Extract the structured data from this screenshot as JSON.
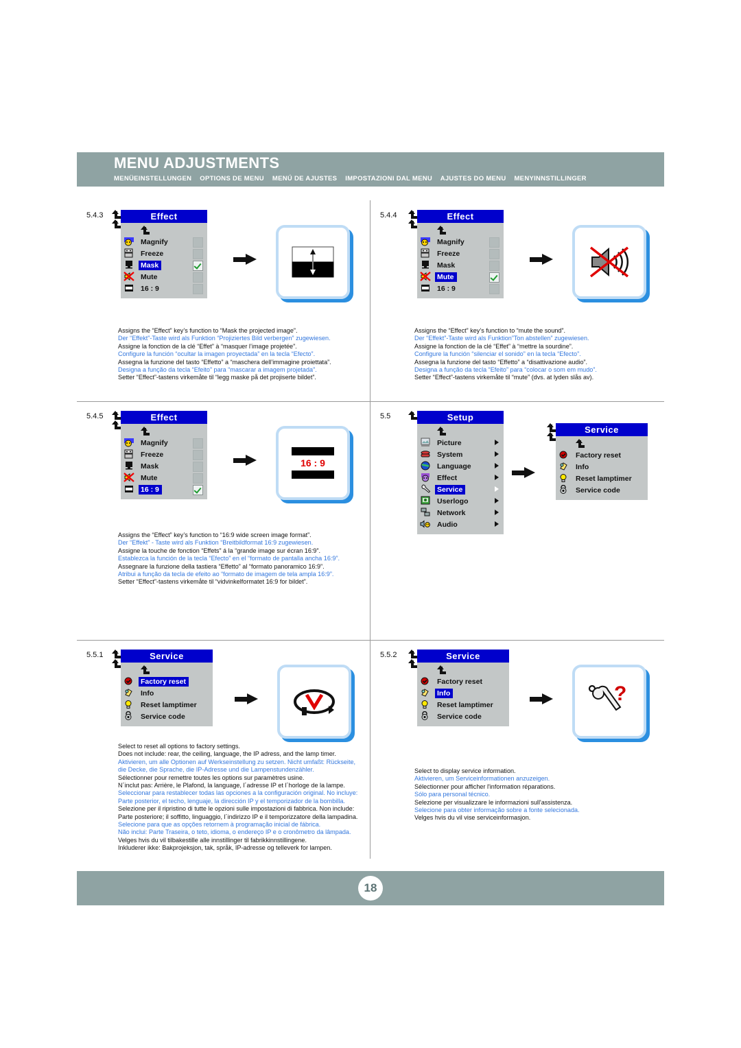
{
  "header": {
    "title": "MENU ADJUSTMENTS",
    "subtitles": [
      "MENÜEINSTELLUNGEN",
      "OPTIONS DE MENU",
      "MENÚ DE AJUSTES",
      "IMPOSTAZIONI DAL MENU",
      "AJUSTES DO MENU",
      "MENYINNSTILLINGER"
    ]
  },
  "footer": {
    "page": "18"
  },
  "colors": {
    "header_bar": "#8fa3a3",
    "osd_title_bg": "#0000cc",
    "osd_body_bg": "#c3c7c7",
    "highlight": "#0000cc",
    "blue_text": "#3377dd",
    "preview_border": "#bfdcf5",
    "preview_shadow": "#2b8fe0",
    "check_green": "#1f9b2f"
  },
  "sections": [
    {
      "id": "5.4.3",
      "number": "5.4.3",
      "menu": {
        "title": "Effect",
        "items": [
          {
            "label": "Magnify",
            "icon": "magnify-icon",
            "selected": false,
            "checkbox": true
          },
          {
            "label": "Freeze",
            "icon": "freeze-icon",
            "selected": false,
            "checkbox": true
          },
          {
            "label": "Mask",
            "icon": "mask-icon",
            "selected": true,
            "checkbox": true
          },
          {
            "label": "Mute",
            "icon": "mute-icon",
            "selected": false,
            "checkbox": true
          },
          {
            "label": "16 : 9",
            "icon": "widescreen-icon",
            "selected": false,
            "checkbox": true
          }
        ]
      },
      "preview": "mask-preview",
      "text": {
        "en": "Assigns the “Effect” key’s function to “Mask the projected image”.",
        "de": "Der “Effekt”-Taste wird als Funktion “Projiziertes Bild verbergen” zugewiesen.",
        "fr": "Assigne la fonction de la clé “Effet” à “masquer l’image projetée”.",
        "es": "Configure la función “ocultar la imagen proyectada” en la tecla “Efecto”.",
        "it": "Assegna la funzione del tasto “Effetto” a “maschera dell’immagine proiettata”.",
        "pt": "Designa a função da tecla “Efeito” para “mascarar a imagem projetada”.",
        "no": "Setter “Effect”-tastens virkemåte til “legg maske på det projiserte bildet”."
      }
    },
    {
      "id": "5.4.4",
      "number": "5.4.4",
      "menu": {
        "title": "Effect",
        "items": [
          {
            "label": "Magnify",
            "icon": "magnify-icon",
            "selected": false,
            "checkbox": true
          },
          {
            "label": "Freeze",
            "icon": "freeze-icon",
            "selected": false,
            "checkbox": true
          },
          {
            "label": "Mask",
            "icon": "mask-icon",
            "selected": false,
            "checkbox": true
          },
          {
            "label": "Mute",
            "icon": "mute-icon",
            "selected": true,
            "checkbox": true
          },
          {
            "label": "16 : 9",
            "icon": "widescreen-icon",
            "selected": false,
            "checkbox": true
          }
        ]
      },
      "preview": "mute-preview",
      "text": {
        "en": "Assigns the “Effect” key’s function to “mute the sound”.",
        "de": "Der “Effekt”-Taste wird als Funktion”Ton abstellen” zugewiesen.",
        "fr": "Assigne la fonction de la clé “Effet” à “mettre la sourdine”.",
        "es": "Configure la función “silenciar el sonido” en la tecla “Efecto”.",
        "it": "Assegna la funzione del tasto “Effetto” a “disattivazione audio”.",
        "pt": "Designa a função da tecla “Efeito” para “colocar o som em mudo”.",
        "no": "Setter “Effect”-tastens virkemåte til “mute” (dvs. at lyden slås av)."
      }
    },
    {
      "id": "5.4.5",
      "number": "5.4.5",
      "menu": {
        "title": "Effect",
        "items": [
          {
            "label": "Magnify",
            "icon": "magnify-icon",
            "selected": false,
            "checkbox": true
          },
          {
            "label": "Freeze",
            "icon": "freeze-icon",
            "selected": false,
            "checkbox": true
          },
          {
            "label": "Mask",
            "icon": "mask-icon",
            "selected": false,
            "checkbox": true
          },
          {
            "label": "Mute",
            "icon": "mute-icon",
            "selected": false,
            "checkbox": true
          },
          {
            "label": "16 : 9",
            "icon": "widescreen-icon",
            "selected": true,
            "checkbox": true
          }
        ]
      },
      "preview": "widescreen-preview",
      "preview_label": "16 : 9",
      "text": {
        "en": "Assigns the “Effect” key’s function to “16:9 wide screen image format”.",
        "de": "Der “Effekt” - Taste wird als Funktion “Breitbildformat 16:9 zugewiesen.",
        "fr": "Assigne la touche de fonction “Effets” á la “grande image sur écran 16:9”.",
        "es": "Establezca la función de la tecla “Efecto” en el “formato de pantalla ancha 16:9”.",
        "it": "Assegnare la funzione della tastiera “Effetto” al “formato panoramico 16:9”.",
        "pt": "Atribui a função da tecla de efeito ao “formato de imagem de tela ampla 16:9”.",
        "no": "Setter “Effect”-tastens virkemåte til “vidvinkelformatet 16:9 for bildet”."
      }
    },
    {
      "id": "5.5",
      "number": "5.5",
      "menu": {
        "title": "Setup",
        "items": [
          {
            "label": "Picture",
            "icon": "picture-icon",
            "selected": false,
            "submenu": true
          },
          {
            "label": "System",
            "icon": "system-icon",
            "selected": false,
            "submenu": true
          },
          {
            "label": "Language",
            "icon": "language-icon",
            "selected": false,
            "submenu": true
          },
          {
            "label": "Effect",
            "icon": "effect-icon",
            "selected": false,
            "submenu": true
          },
          {
            "label": "Service",
            "icon": "service-icon",
            "selected": true,
            "submenu": true
          },
          {
            "label": "Userlogo",
            "icon": "userlogo-icon",
            "selected": false,
            "submenu": true
          },
          {
            "label": "Network",
            "icon": "network-icon",
            "selected": false,
            "submenu": true
          },
          {
            "label": "Audio",
            "icon": "audio-icon",
            "selected": false,
            "submenu": true
          }
        ]
      },
      "submenu": {
        "title": "Service",
        "items": [
          {
            "label": "Factory reset",
            "icon": "factory-reset-icon",
            "selected": false
          },
          {
            "label": "Info",
            "icon": "info-icon",
            "selected": false
          },
          {
            "label": "Reset lamptimer",
            "icon": "lamp-icon",
            "selected": false
          },
          {
            "label": "Service code",
            "icon": "servicecode-icon",
            "selected": false
          }
        ]
      },
      "text": {}
    },
    {
      "id": "5.5.1",
      "number": "5.5.1",
      "menu": {
        "title": "Service",
        "items": [
          {
            "label": "Factory reset",
            "icon": "factory-reset-icon",
            "selected": true
          },
          {
            "label": "Info",
            "icon": "info-icon",
            "selected": false
          },
          {
            "label": "Reset lamptimer",
            "icon": "lamp-icon",
            "selected": false
          },
          {
            "label": "Service code",
            "icon": "servicecode-icon",
            "selected": false
          }
        ]
      },
      "preview": "factory-reset-preview",
      "text": {
        "en1": "Select to reset all options to factory settings.",
        "en2": "Does not include: rear, the ceiling, language, the IP adress, and the lamp timer.",
        "de1": "Aktivieren, um alle Optionen auf Werkseinstellung zu setzen. Nicht umfaßt: Rückseite,",
        "de2": "die Decke, die Sprache, die IP-Adresse und die Lampenstundenzähler.",
        "fr1": "Sélectionner pour remettre toutes les options sur paramètres usine.",
        "fr2": "N´inclut pas: Arrière, le Plafond, la language, l´adresse IP et l´horloge de la lampe.",
        "es1": "Seleccionar para restablecer todas las opciones a la configuración original. No incluye:",
        "es2": "Parte posterior, el techo, lenguaje, la dirección IP y el temporizador de la bombilla.",
        "it1": "Selezione per il ripristino di tutte le opzioni sulle impostazioni di fabbrica. Non include:",
        "it2": "Parte posteriore; il soffitto, linguaggio, l´indirizzo IP e il temporizzatore della lampadina.",
        "pt1": "Selecione para que as opções retornem à programação inicial de fábrica.",
        "pt2": "Não inclui: Parte Traseira, o teto, idioma, o endereço IP e o cronômetro da lâmpada.",
        "no1": "Velges hvis du vil tilbakestille alle innstillinger til fabrikkinnstillingene.",
        "no2": "Inkluderer ikke: Bakprojeksjon, tak, språk, IP-adresse og telleverk for lampen."
      }
    },
    {
      "id": "5.5.2",
      "number": "5.5.2",
      "menu": {
        "title": "Service",
        "items": [
          {
            "label": "Factory reset",
            "icon": "factory-reset-icon",
            "selected": false
          },
          {
            "label": "Info",
            "icon": "info-icon",
            "selected": true
          },
          {
            "label": "Reset lamptimer",
            "icon": "lamp-icon",
            "selected": false
          },
          {
            "label": "Service code",
            "icon": "servicecode-icon",
            "selected": false
          }
        ]
      },
      "preview": "service-info-preview",
      "text": {
        "en": "Select to display service information.",
        "de": "Aktivieren, um Serviceinformationen anzuzeigen.",
        "fr": "Sélectionner pour afficher l'information réparations.",
        "es": "Sólo para personal técnico.",
        "it": "Selezione per visualizzare le informazioni sull'assistenza.",
        "pt": "Selecione para obter informação sobre a fonte selecionada.",
        "no": "Velges hvis du vil vise serviceinformasjon."
      }
    }
  ]
}
